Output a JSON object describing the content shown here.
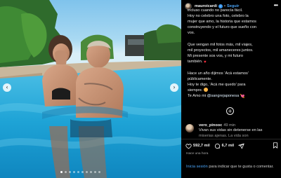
{
  "post": {
    "username": "mauroicardi",
    "separator": "•",
    "follow_label": "Seguir",
    "more_label": "•••",
    "nav_prev_label": "‹",
    "nav_next_label": "›",
    "slide_count": 10,
    "active_slide": 1
  },
  "caption": {
    "line1": "incluso cuando no parecía fácil.",
    "line2": "Hoy no celebro una foto, celebro la",
    "line3": "mujer que amo, la historia que estamos",
    "line4": "construyendo y el futuro que sueño con",
    "line5": "vos.",
    "line6": "Que vengan mil fotos más, mil viajes,",
    "line7": "mil proyectos, mil amaneceres juntos.",
    "line8": "Mi presente sos vos, y mi futuro",
    "line9": "también.",
    "line10": "Hace un año dijimos ‘Acá estamos’",
    "line11": "públicamente.",
    "line12": "Hoy te digo, ‘Acá me quedo’ para",
    "line13": "siempre.",
    "line14_prefix": "Te Amo mi",
    "mention": "@sangrejaponesa",
    "heart_red": "♥",
    "heart_pink": "💘"
  },
  "load_more_label": "+",
  "comment": {
    "username": "vero_pinooc",
    "time": "49 min",
    "text": "Vivan sus vidas sin detenerse en las",
    "text_fade": "miserias ajenas. La vida son"
  },
  "actions": {
    "likes_count": "592,7 mil",
    "comments_count": "6,7 mil"
  },
  "time_ago": "Hace una hora",
  "login": {
    "link": "Inicia sesión",
    "text": "para indicar que te gusta o comentar."
  }
}
